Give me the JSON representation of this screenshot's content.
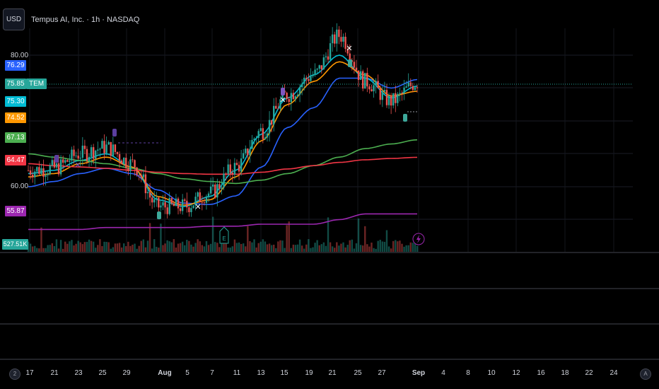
{
  "header": {
    "currency": "USD",
    "symbol_title": "Tempus AI, Inc. · 1h · NASDAQ"
  },
  "price_axis": {
    "plain_labels": [
      "80.00",
      "60.00"
    ],
    "tags": [
      {
        "label": "76.29",
        "color": "#2962ff"
      },
      {
        "label": "75.85",
        "color": "#26a69a"
      },
      {
        "label": "75.30",
        "color": "#00bcd4"
      },
      {
        "label": "74.52",
        "color": "#ff9800"
      },
      {
        "label": "67.13",
        "color": "#4caf50"
      },
      {
        "label": "64.47",
        "color": "#f23645"
      },
      {
        "label": "55.87",
        "color": "#9c27b0"
      }
    ],
    "ticker_tag": "TEM",
    "volume_tag": "527.51K"
  },
  "time_axis": {
    "left_button": "2",
    "right_button": "A",
    "labels": [
      {
        "text": "17",
        "bold": false
      },
      {
        "text": "21",
        "bold": false
      },
      {
        "text": "23",
        "bold": false
      },
      {
        "text": "25",
        "bold": false
      },
      {
        "text": "29",
        "bold": false
      },
      {
        "text": "Aug",
        "bold": true
      },
      {
        "text": "5",
        "bold": false
      },
      {
        "text": "7",
        "bold": false
      },
      {
        "text": "11",
        "bold": false
      },
      {
        "text": "13",
        "bold": false
      },
      {
        "text": "15",
        "bold": false
      },
      {
        "text": "19",
        "bold": false
      },
      {
        "text": "21",
        "bold": false
      },
      {
        "text": "25",
        "bold": false
      },
      {
        "text": "27",
        "bold": false
      },
      {
        "text": "Sep",
        "bold": true
      },
      {
        "text": "4",
        "bold": false
      },
      {
        "text": "8",
        "bold": false
      },
      {
        "text": "10",
        "bold": false
      },
      {
        "text": "12",
        "bold": false
      },
      {
        "text": "16",
        "bold": false
      },
      {
        "text": "18",
        "bold": false
      },
      {
        "text": "22",
        "bold": false
      },
      {
        "text": "24",
        "bold": false
      }
    ]
  },
  "chart_data": {
    "type": "line",
    "title": "Tempus AI, Inc. · 1h · NASDAQ",
    "ylim": [
      52,
      84
    ],
    "last_price": 75.85,
    "x": [
      "Jul 17",
      "Jul 21",
      "Jul 23",
      "Jul 25",
      "Jul 29",
      "Aug 1",
      "Aug 5",
      "Aug 7",
      "Aug 11",
      "Aug 13",
      "Aug 15",
      "Aug 19",
      "Aug 21",
      "Aug 25",
      "Aug 27",
      "Aug 29"
    ],
    "price": [
      62.5,
      62.8,
      65.0,
      66.0,
      63.5,
      57.0,
      57.0,
      59.0,
      63.0,
      68.5,
      74.0,
      77.0,
      83.0,
      76.0,
      73.0,
      75.85
    ],
    "series": [
      {
        "color": "#2962ff",
        "values": [
          60.0,
          60.8,
          62.0,
          62.8,
          62.0,
          59.5,
          57.5,
          57.3,
          58.6,
          63.0,
          69.0,
          72.0,
          76.5,
          76.5,
          75.0,
          76.29
        ]
      },
      {
        "color": "#00bcd4",
        "values": [
          62.0,
          62.5,
          64.0,
          65.0,
          63.0,
          58.0,
          57.0,
          58.5,
          62.5,
          68.0,
          73.5,
          77.0,
          80.0,
          76.5,
          73.5,
          75.3
        ]
      },
      {
        "color": "#ff9800",
        "values": [
          61.5,
          62.0,
          63.5,
          64.5,
          63.0,
          58.5,
          57.2,
          58.0,
          61.5,
          67.0,
          72.5,
          76.0,
          79.0,
          77.0,
          73.8,
          74.52
        ]
      },
      {
        "color": "#4caf50",
        "values": [
          65.0,
          64.5,
          64.0,
          63.5,
          62.8,
          62.0,
          61.2,
          60.8,
          60.5,
          61.0,
          62.0,
          63.2,
          64.5,
          65.8,
          66.5,
          67.13
        ]
      },
      {
        "color": "#f23645",
        "values": [
          63.5,
          63.2,
          63.0,
          62.8,
          62.5,
          62.2,
          62.0,
          61.9,
          61.9,
          62.2,
          62.7,
          63.2,
          63.7,
          64.1,
          64.3,
          64.47
        ]
      },
      {
        "color": "#9c27b0",
        "values": [
          53.5,
          53.5,
          53.5,
          53.8,
          53.8,
          53.8,
          53.8,
          54.0,
          54.0,
          54.3,
          54.3,
          54.3,
          55.0,
          55.87,
          55.87,
          55.87
        ]
      }
    ]
  }
}
